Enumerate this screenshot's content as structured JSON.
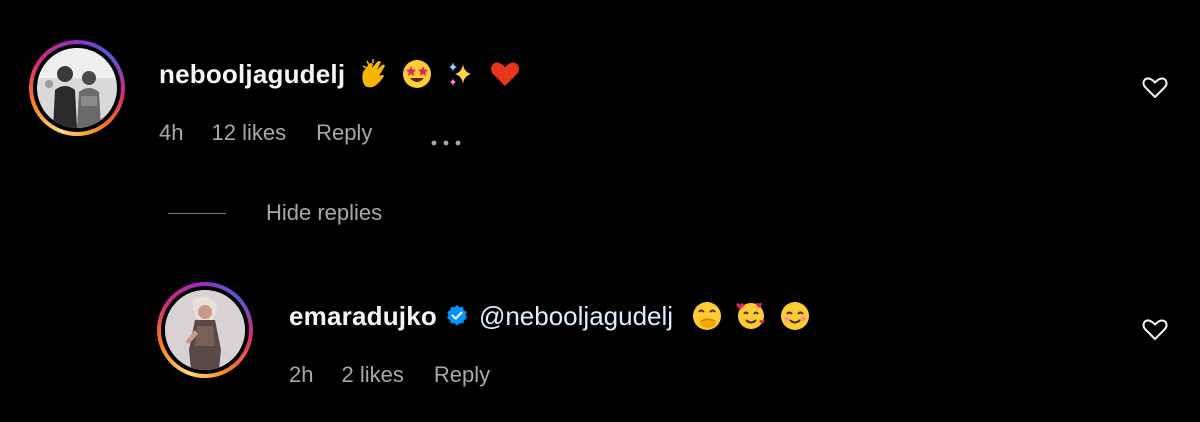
{
  "comments": [
    {
      "username": "nebooljagudelj",
      "emojis": [
        "clapping-hands",
        "star-struck",
        "sparkles",
        "red-heart"
      ],
      "time": "4h",
      "likes": "12 likes",
      "reply_label": "Reply"
    },
    {
      "username": "emaradujko",
      "verified": true,
      "mention": "@nebooljagudelj",
      "emojis": [
        "face-with-hand-over-mouth",
        "smiling-face-with-hearts",
        "smiling-face-with-smiling-eyes"
      ],
      "time": "2h",
      "likes": "2 likes",
      "reply_label": "Reply"
    }
  ],
  "hide_replies_label": "Hide replies",
  "colors": {
    "background": "#000000",
    "primary_text": "#f5f5f5",
    "secondary_text": "#a8a8a8",
    "verified_blue": "#0095f6"
  }
}
